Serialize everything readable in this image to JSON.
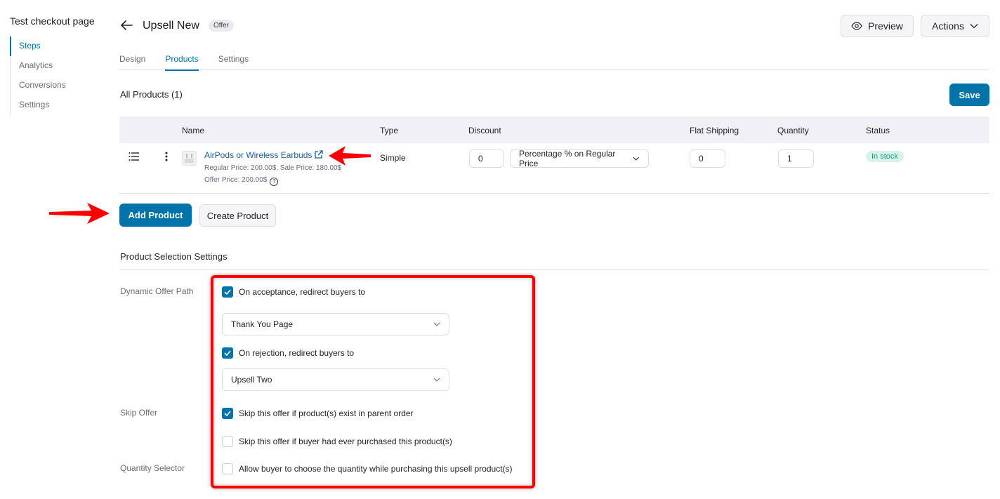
{
  "sidebar": {
    "title": "Test checkout page",
    "items": [
      {
        "label": "Steps",
        "active": true
      },
      {
        "label": "Analytics",
        "active": false
      },
      {
        "label": "Conversions",
        "active": false
      },
      {
        "label": "Settings",
        "active": false
      }
    ]
  },
  "header": {
    "title": "Upsell New",
    "badge": "Offer",
    "preview_label": "Preview",
    "actions_label": "Actions"
  },
  "tabs": [
    {
      "label": "Design",
      "active": false
    },
    {
      "label": "Products",
      "active": true
    },
    {
      "label": "Settings",
      "active": false
    }
  ],
  "products": {
    "heading": "All Products (1)",
    "save_label": "Save",
    "columns": [
      "Name",
      "Type",
      "Discount",
      "Flat Shipping",
      "Quantity",
      "Status"
    ],
    "rows": [
      {
        "name": "AirPods or Wireless Earbuds",
        "prices": "Regular Price: 200.00$, Sale Price: 180.00$",
        "offer_price": "Offer Price: 200.00$",
        "type": "Simple",
        "discount_value": "0",
        "discount_type": "Percentage % on Regular Price",
        "flat_shipping": "0",
        "quantity": "1",
        "status": "In stock"
      }
    ],
    "add_label": "Add Product",
    "create_label": "Create Product"
  },
  "selection_settings": {
    "heading": "Product Selection Settings",
    "dynamic_offer_path": {
      "label": "Dynamic Offer Path",
      "acceptance": {
        "label": "On acceptance, redirect buyers to",
        "checked": true,
        "selected": "Thank You Page"
      },
      "rejection": {
        "label": "On rejection, redirect buyers to",
        "checked": true,
        "selected": "Upsell Two"
      }
    },
    "skip_offer": {
      "label": "Skip Offer",
      "options": [
        {
          "label": "Skip this offer if product(s) exist in parent order",
          "checked": true
        },
        {
          "label": "Skip this offer if buyer had ever purchased this product(s)",
          "checked": false
        }
      ]
    },
    "quantity_selector": {
      "label": "Quantity Selector",
      "option": {
        "label": "Allow buyer to choose the quantity while purchasing this upsell product(s)",
        "checked": false
      }
    }
  },
  "colors": {
    "accent": "#0073aa",
    "annotation": "#ff0000",
    "status_bg": "#d9f3ec",
    "status_text": "#1e9c7b"
  }
}
